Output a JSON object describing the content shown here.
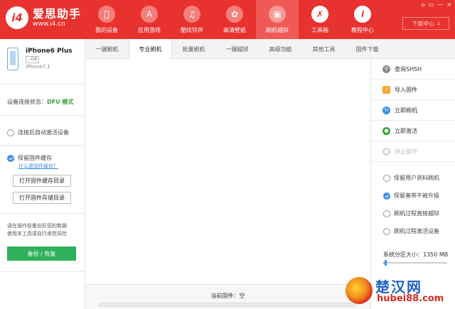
{
  "app": {
    "logo_mark": "i4",
    "logo_name": "爱思助手",
    "logo_url": "www.i4.cn"
  },
  "nav": [
    {
      "label": "我的设备",
      "icon": "apple-icon"
    },
    {
      "label": "应用游戏",
      "icon": "app-store-icon"
    },
    {
      "label": "酷炫铃声",
      "icon": "bell-icon"
    },
    {
      "label": "高清壁纸",
      "icon": "flower-icon"
    },
    {
      "label": "刷机越狱",
      "icon": "box-icon"
    },
    {
      "label": "工具箱",
      "icon": "tools-icon"
    },
    {
      "label": "教程中心",
      "icon": "info-icon"
    }
  ],
  "window_controls": [
    "⌂",
    "▭",
    "—",
    "×"
  ],
  "download_center": "下载中心",
  "device": {
    "name": "iPhone6 Plus",
    "capacity": "--GB",
    "os": "iPhone7,1"
  },
  "status": {
    "label": "设备连接状态：",
    "value": "DFU 模式"
  },
  "sidebar": {
    "auto_activate": "连接后自动激活设备",
    "keep_cache": "保留固件缓存",
    "what_is_cache": "什么是固件缓存？",
    "open_cache_dir": "打开固件缓存目录",
    "open_store_dir": "打开固件存储目录",
    "warning_line1": "请在操作前备份好您的数据",
    "warning_line2": "使用本工具请自行承担风险",
    "backup_restore": "备份 / 恢复"
  },
  "tabs": [
    "一键刷机",
    "专业刷机",
    "批量刷机",
    "一键越狱",
    "高级功能",
    "其他工具",
    "固件下载"
  ],
  "active_tab": 1,
  "firmware": {
    "current_label": "当前固件：空"
  },
  "actions": [
    {
      "label": "查询SHSH",
      "icon": "search-icon",
      "color": "#8a8a8a",
      "enabled": true
    },
    {
      "label": "导入固件",
      "icon": "import-icon",
      "color": "#f2a530",
      "enabled": true
    },
    {
      "label": "立即刷机",
      "icon": "flash-icon",
      "color": "#3f8ee6",
      "enabled": true
    },
    {
      "label": "立即激活",
      "icon": "globe-icon",
      "color": "#36a03a",
      "enabled": true
    },
    {
      "label": "停止操作",
      "icon": "stop-icon",
      "color": "#cccccc",
      "enabled": false
    }
  ],
  "options": [
    {
      "label": "保留用户资料刷机",
      "checked": false
    },
    {
      "label": "保留基带不被升级",
      "checked": true
    },
    {
      "label": "刷机过程直接越狱",
      "checked": false
    },
    {
      "label": "刷机过程激活设备",
      "checked": false
    }
  ],
  "partition": {
    "label": "系统分区大小：1350 MB",
    "slider_fraction": 0.02
  },
  "watermark": {
    "title": "楚汉网",
    "url": "hubei88.com"
  },
  "colors": {
    "brand_red": "#e8322f",
    "accent_blue": "#3f8ee6",
    "success_green": "#2eb15a"
  }
}
